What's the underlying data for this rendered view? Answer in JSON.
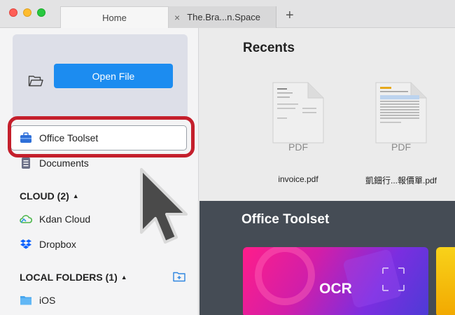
{
  "tabs": [
    {
      "label": "Home",
      "active": true
    },
    {
      "label": "The.Bra...n.Space",
      "active": false,
      "close_glyph": "×"
    }
  ],
  "new_tab_glyph": "+",
  "sidebar": {
    "open_file_label": "Open File",
    "items": [
      {
        "label": "Office Toolset",
        "icon": "toolbox-icon"
      },
      {
        "label": "Documents",
        "icon": "document-icon"
      }
    ],
    "cloud": {
      "title": "CLOUD (2)",
      "items": [
        {
          "label": "Kdan Cloud",
          "icon": "kdan-cloud-icon"
        },
        {
          "label": "Dropbox",
          "icon": "dropbox-icon"
        }
      ]
    },
    "local": {
      "title": "LOCAL FOLDERS (1)",
      "items": [
        {
          "label": "iOS",
          "icon": "folder-icon"
        }
      ]
    },
    "caret": "▲"
  },
  "recents": {
    "title": "Recents",
    "files": [
      {
        "name": "invoice.pdf",
        "type": "PDF"
      },
      {
        "name": "凱鈿行...報價單.pdf",
        "type": "PDF"
      }
    ]
  },
  "office_toolset": {
    "title": "Office Toolset",
    "cards": [
      {
        "label": "OCR"
      }
    ]
  },
  "colors": {
    "accent": "#1c8cf0",
    "highlight": "#c41f2c",
    "dark_panel": "#454c55"
  }
}
